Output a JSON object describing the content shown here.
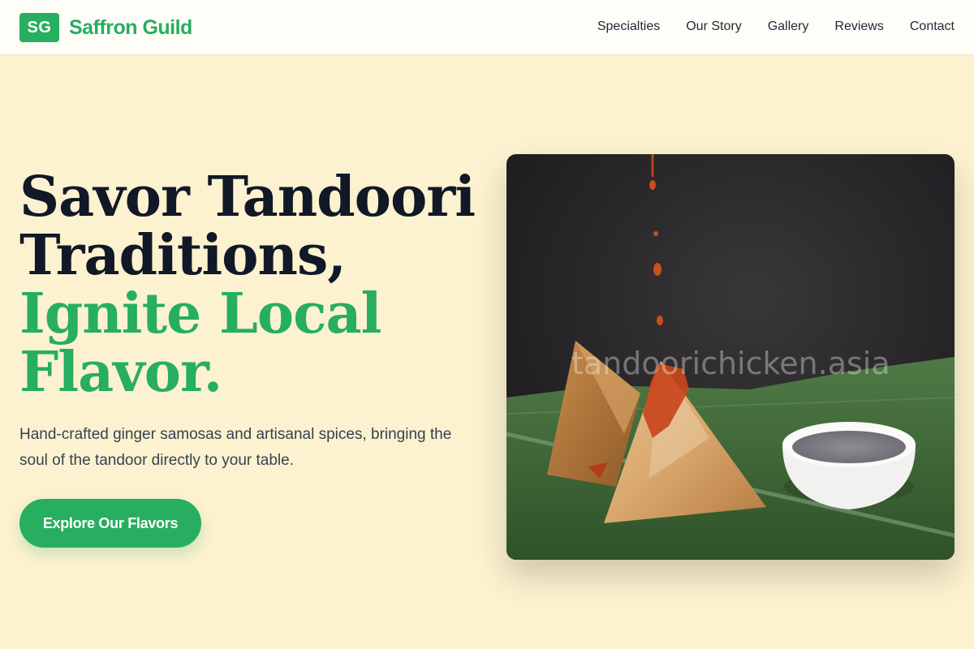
{
  "header": {
    "logo_badge": "SG",
    "brand_name": "Saffron Guild",
    "nav": [
      "Specialties",
      "Our Story",
      "Gallery",
      "Reviews",
      "Contact"
    ]
  },
  "hero": {
    "headline_line1": "Savor Tandoori",
    "headline_line2": "Traditions,",
    "headline_line3": "Ignite Local",
    "headline_line4": "Flavor.",
    "subtitle": "Hand-crafted ginger samosas and artisanal spices, bringing the soul of the tandoor directly to your table.",
    "cta_label": "Explore Our Flavors",
    "image_watermark": "tandoorichicken.asia"
  },
  "colors": {
    "accent": "#27ae60",
    "background": "#fdf2cf",
    "heading": "#111827"
  }
}
